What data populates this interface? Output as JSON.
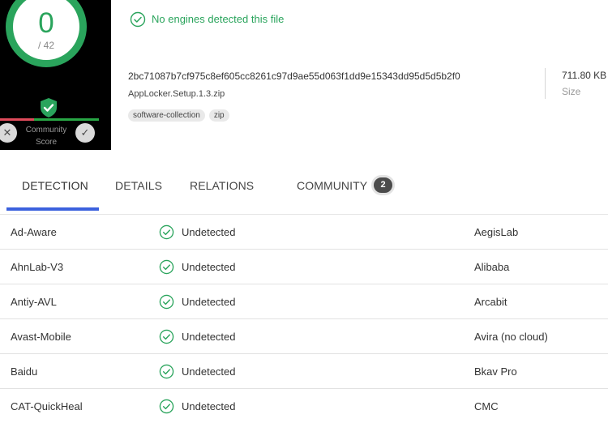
{
  "score": {
    "detections": "0",
    "total": "/ 42",
    "community_label_1": "Community",
    "community_label_2": "Score"
  },
  "status": {
    "text": "No engines detected this file"
  },
  "file": {
    "hash": "2bc71087b7cf975c8ef605cc8261c97d9ae55d063f1dd9e15343dd95d5d5b2f0",
    "name": "AppLocker.Setup.1.3.zip",
    "tags": [
      "software-collection",
      "zip"
    ],
    "size": "711.80 KB",
    "size_label": "Size"
  },
  "tabs": {
    "detection": "DETECTION",
    "details": "DETAILS",
    "relations": "RELATIONS",
    "community": "COMMUNITY",
    "community_count": "2"
  },
  "rows": [
    {
      "engine": "Ad-Aware",
      "result": "Undetected",
      "engine2": "AegisLab"
    },
    {
      "engine": "AhnLab-V3",
      "result": "Undetected",
      "engine2": "Alibaba"
    },
    {
      "engine": "Antiy-AVL",
      "result": "Undetected",
      "engine2": "Arcabit"
    },
    {
      "engine": "Avast-Mobile",
      "result": "Undetected",
      "engine2": "Avira (no cloud)"
    },
    {
      "engine": "Baidu",
      "result": "Undetected",
      "engine2": "Bkav Pro"
    },
    {
      "engine": "CAT-QuickHeal",
      "result": "Undetected",
      "engine2": "CMC"
    }
  ],
  "colors": {
    "accent": "#3b61de",
    "clean": "#2aa45c",
    "malicious": "#e04b5b"
  }
}
